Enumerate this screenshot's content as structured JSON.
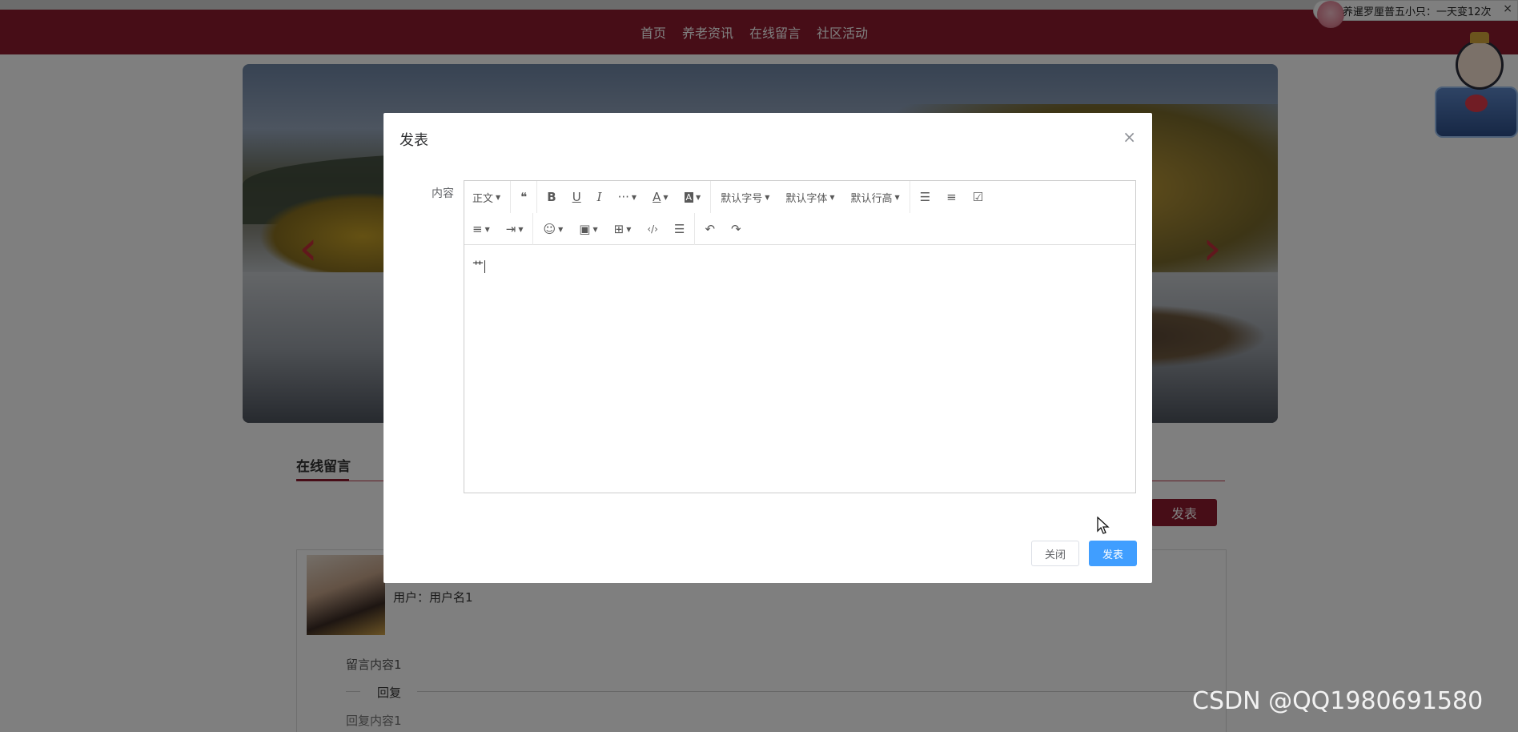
{
  "nav": {
    "items": [
      "首页",
      "养老资讯",
      "在线留言",
      "社区活动"
    ]
  },
  "banner": {
    "prev_icon": "chevron-left-icon",
    "next_icon": "chevron-right-icon"
  },
  "section": {
    "title": "在线留言",
    "post_button": "发表"
  },
  "message": {
    "user": "用户：用户名1",
    "content": "留言内容1",
    "reply_label": "回复",
    "reply_content": "回复内容1"
  },
  "ad": {
    "text": "养暹罗厘普五小只：一天变12次",
    "close": "×"
  },
  "modal": {
    "title": "发表",
    "close": "×",
    "field_label": "内容",
    "editor_text": "艹",
    "cancel_label": "关闭",
    "submit_label": "发表"
  },
  "toolbar": {
    "row1": [
      {
        "label": "正文",
        "dropdown": true,
        "icon": "paragraph-style"
      },
      {
        "label": "",
        "icon": "quote-icon"
      },
      {
        "label": "",
        "icon": "bold-icon"
      },
      {
        "label": "",
        "icon": "underline-icon"
      },
      {
        "label": "",
        "icon": "italic-icon"
      },
      {
        "label": "",
        "icon": "more-icon",
        "dropdown": true
      },
      {
        "label": "",
        "icon": "font-color-icon",
        "dropdown": true
      },
      {
        "label": "",
        "icon": "bg-color-icon",
        "dropdown": true
      },
      {
        "label": "默认字号",
        "dropdown": true,
        "icon": "font-size"
      },
      {
        "label": "默认字体",
        "dropdown": true,
        "icon": "font-family"
      },
      {
        "label": "默认行高",
        "dropdown": true,
        "icon": "line-height"
      },
      {
        "label": "",
        "icon": "bullet-list-icon"
      },
      {
        "label": "",
        "icon": "numbered-list-icon"
      },
      {
        "label": "",
        "icon": "todo-icon"
      }
    ],
    "row2": [
      {
        "label": "",
        "icon": "align-icon",
        "dropdown": true
      },
      {
        "label": "",
        "icon": "indent-icon",
        "dropdown": true
      },
      {
        "label": "",
        "icon": "emoji-icon",
        "dropdown": true
      },
      {
        "label": "",
        "icon": "image-icon",
        "dropdown": true
      },
      {
        "label": "",
        "icon": "table-icon",
        "dropdown": true
      },
      {
        "label": "",
        "icon": "code-icon"
      },
      {
        "label": "",
        "icon": "divider-icon"
      },
      {
        "label": "",
        "icon": "undo-icon"
      },
      {
        "label": "",
        "icon": "redo-icon"
      }
    ]
  },
  "watermark": "CSDN @QQ1980691580",
  "colors": {
    "nav_bg": "#8e1b2e",
    "primary_button": "#409eff",
    "overlay": "rgba(0,0,0,0.5)"
  }
}
